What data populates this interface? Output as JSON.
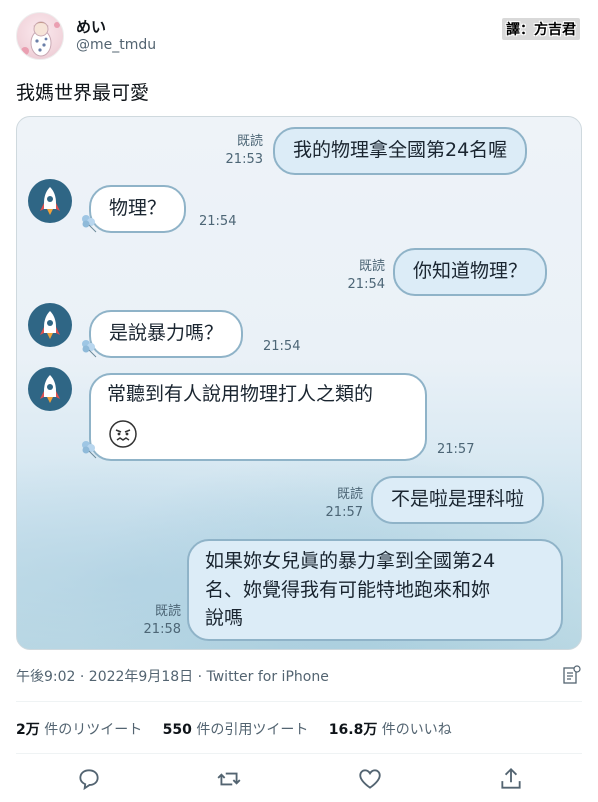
{
  "user": {
    "name": "めい",
    "handle": "@me_tmdu",
    "credit": "譯：方吉君"
  },
  "tweet": {
    "text": "我媽世界最可愛",
    "timestamp": "午後9:02 · 2022年9月18日 · Twitter for iPhone"
  },
  "chat": {
    "messages": [
      {
        "dir": "out",
        "text": "我的物理拿全國第24名喔",
        "read": "既読",
        "time": "21:53"
      },
      {
        "dir": "in",
        "text": "物理？",
        "time": "21:54"
      },
      {
        "dir": "out",
        "text": "你知道物理？",
        "read": "既読",
        "time": "21:54"
      },
      {
        "dir": "in",
        "text": "是說暴力嗎？",
        "time": "21:54"
      },
      {
        "dir": "in",
        "text": "常聽到有人說用物理打人之類的",
        "emoji": "angry-face",
        "time": "21:57"
      },
      {
        "dir": "out",
        "text": "不是啦是理科啦",
        "read": "既読",
        "time": "21:57"
      },
      {
        "dir": "out",
        "lines": [
          "如果妳女兒眞的暴力拿到全國第24",
          "名、妳覺得我有可能特地跑來和妳",
          "說嗎"
        ],
        "read": "既読",
        "time": "21:58"
      }
    ]
  },
  "stats": {
    "retweets_count": "2万",
    "retweets_label": "件のリツイート",
    "quotes_count": "550",
    "quotes_label": "件の引用ツイート",
    "likes_count": "16.8万",
    "likes_label": "件のいいね"
  },
  "icons": {
    "reply": "reply-icon",
    "retweet": "retweet-icon",
    "like": "heart-icon",
    "share": "share-icon",
    "analytics": "analytics-icon",
    "chat_avatar": "rocket-icon"
  },
  "colors": {
    "bubble_out": "#dcecf7",
    "bubble_in": "#ffffff",
    "bubble_border": "#8fb3c8",
    "chat_avatar_bg": "#2f6685",
    "muted_text": "#536471"
  }
}
